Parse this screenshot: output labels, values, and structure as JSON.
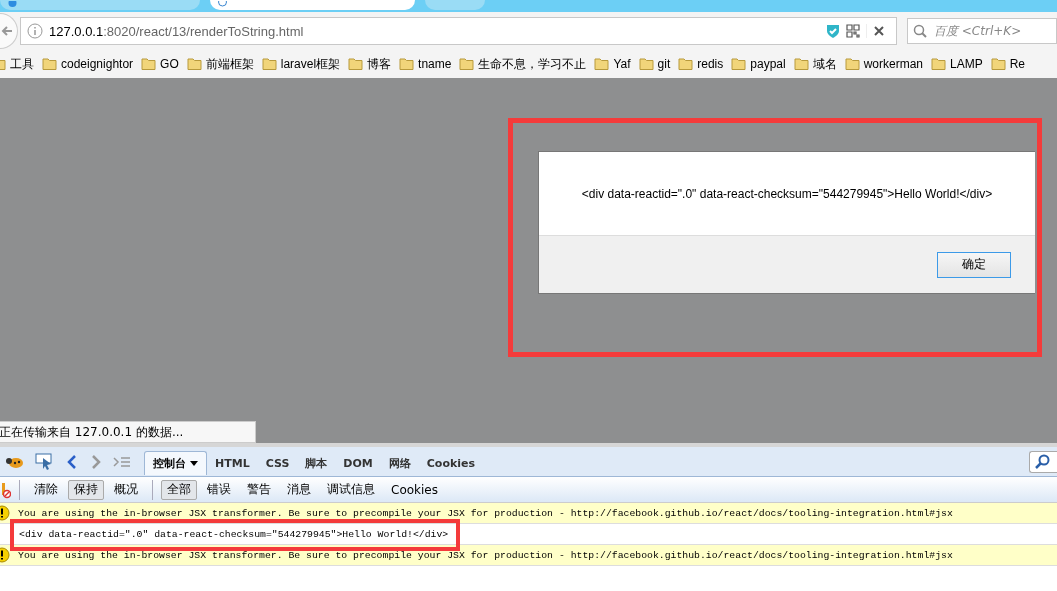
{
  "address_bar": {
    "url_host": "127.0.0.1",
    "url_path": ":8020/react/13/renderToString.html"
  },
  "search": {
    "placeholder": "百度 <Ctrl+K>"
  },
  "bookmarks": [
    "工具",
    "codeignightor",
    "GO",
    "前端框架",
    "laravel框架",
    "博客",
    "tname",
    "生命不息，学习不止",
    "Yaf",
    "git",
    "redis",
    "paypal",
    "域名",
    "workerman",
    "LAMP",
    "Re"
  ],
  "dialog": {
    "message": "<div data-reactid=\".0\" data-react-checksum=\"544279945\">Hello World!</div>",
    "button": "确定"
  },
  "status_tooltip": "正在传输来自 127.0.0.1 的数据...",
  "devtools": {
    "tabs": [
      {
        "label": "控制台",
        "selected": true,
        "dropdown": true
      },
      {
        "label": "HTML",
        "selected": false,
        "dropdown": false
      },
      {
        "label": "CSS",
        "selected": false,
        "dropdown": false
      },
      {
        "label": "脚本",
        "selected": false,
        "dropdown": false
      },
      {
        "label": "DOM",
        "selected": false,
        "dropdown": false
      },
      {
        "label": "网络",
        "selected": false,
        "dropdown": false
      },
      {
        "label": "Cookies",
        "selected": false,
        "dropdown": false
      }
    ],
    "actions": [
      {
        "label": "清除",
        "selected": false
      },
      {
        "label": "保持",
        "selected": true
      },
      {
        "label": "概况",
        "selected": false
      }
    ],
    "filters": [
      {
        "label": "全部",
        "selected": true
      },
      {
        "label": "错误",
        "selected": false
      },
      {
        "label": "警告",
        "selected": false
      },
      {
        "label": "消息",
        "selected": false
      },
      {
        "label": "调试信息",
        "selected": false
      },
      {
        "label": "Cookies",
        "selected": false
      }
    ],
    "console_rows": [
      {
        "kind": "warning",
        "text": "You are using the in-browser JSX transformer. Be sure to precompile your JSX for production - http://facebook.github.io/react/docs/tooling-integration.html#jsx"
      },
      {
        "kind": "log",
        "text": "<div data-reactid=\".0\" data-react-checksum=\"544279945\">Hello World!</div>"
      },
      {
        "kind": "warning",
        "text": "You are using the in-browser JSX transformer. Be sure to precompile your JSX for production - http://facebook.github.io/react/docs/tooling-integration.html#jsx"
      }
    ]
  }
}
